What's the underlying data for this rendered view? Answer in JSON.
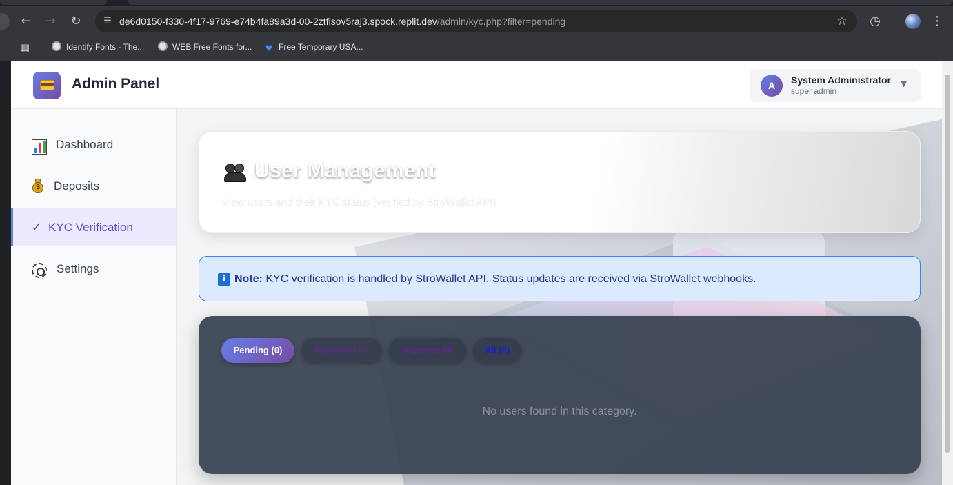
{
  "browser": {
    "url_host": "de6d0150-f330-4f17-9769-e74b4fa89a3d-00-2ztfisov5raj3.spock.replit.dev",
    "url_path": "/admin/kyc.php?filter=pending",
    "bookmarks": [
      {
        "label": "Identify Fonts - The...",
        "icon": "globe-icon"
      },
      {
        "label": "WEB Free Fonts for...",
        "icon": "globe-icon"
      },
      {
        "label": "Free Temporary USA...",
        "icon": "heart-icon"
      }
    ]
  },
  "header": {
    "brand": "Admin Panel",
    "user_initial": "A",
    "user_name": "System Administrator",
    "user_role": "super admin"
  },
  "sidebar": {
    "items": [
      {
        "label": "Dashboard",
        "icon": "bar-chart-icon",
        "active": false
      },
      {
        "label": "Deposits",
        "icon": "money-bag-icon",
        "active": false
      },
      {
        "label": "KYC Verification",
        "icon": "check-icon",
        "active": true
      },
      {
        "label": "Settings",
        "icon": "gear-icon",
        "active": false
      }
    ]
  },
  "main": {
    "hero_title": "User Management",
    "hero_subtitle": "View users and their KYC status (verified by StroWallet API)",
    "note_label": "Note:",
    "note_text": "KYC verification is handled by StroWallet API. Status updates are received via StroWallet webhooks.",
    "filters": [
      {
        "label": "Pending (0)",
        "active": true,
        "color": "#ffffff"
      },
      {
        "label": "Approved (0)",
        "active": false,
        "color": "#5b2a86"
      },
      {
        "label": "Rejected (0)",
        "active": false,
        "color": "#5b2a86"
      },
      {
        "label": "All (0)",
        "active": false,
        "color": "#1b1bd6"
      }
    ],
    "empty_message": "No users found in this category."
  },
  "colors": {
    "accent_start": "#667eea",
    "accent_end": "#764ba2",
    "note_bg": "#dbeafe",
    "panel_bg": "#374151"
  }
}
